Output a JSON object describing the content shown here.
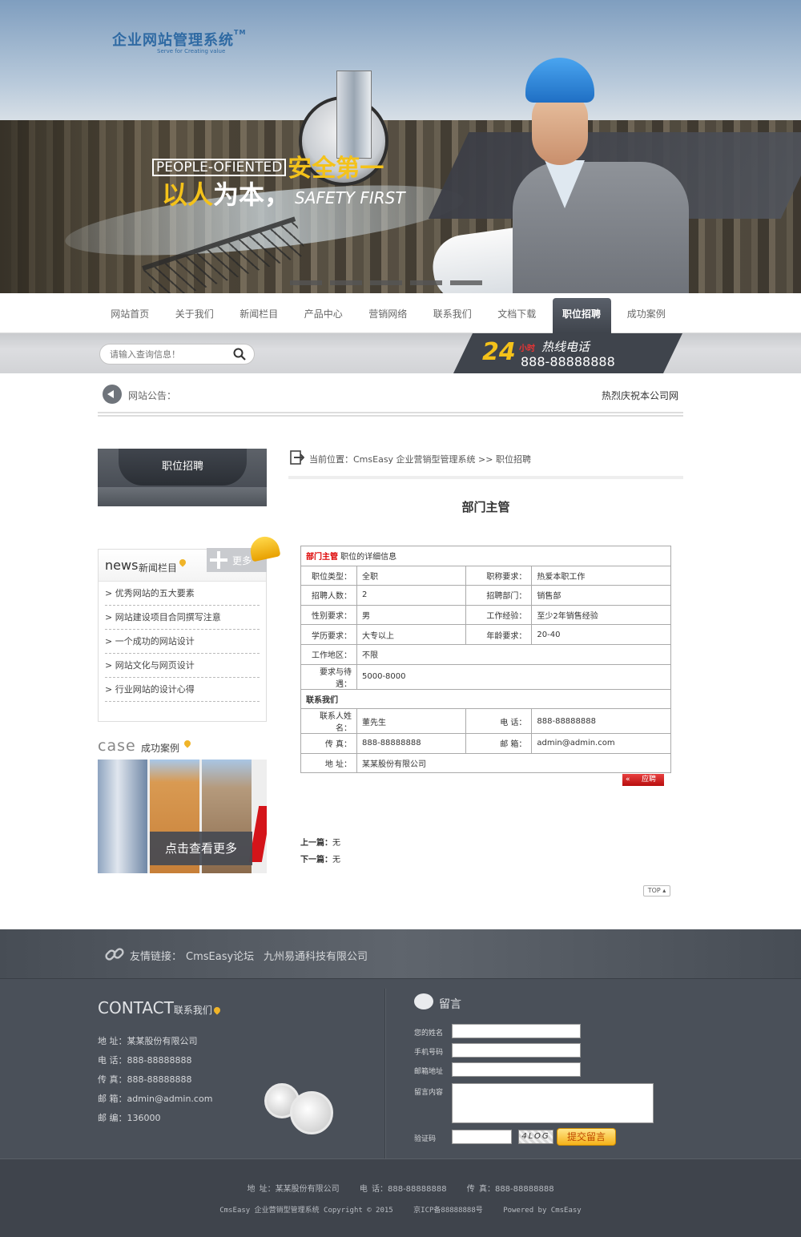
{
  "banner": {
    "logo_title": "企业网站管理系统",
    "logo_tm": "TM",
    "logo_sub": "Serve for Creating value",
    "slogan_en": "PEOPLE-OFIENTED",
    "slogan_cn1": "安全第一",
    "slogan_cn2_a": "以人",
    "slogan_cn2_b": "为本，",
    "slogan_en2": "SAFETY FIRST"
  },
  "nav": {
    "items": [
      {
        "label": "网站首页"
      },
      {
        "label": "关于我们"
      },
      {
        "label": "新闻栏目"
      },
      {
        "label": "产品中心"
      },
      {
        "label": "营销网络"
      },
      {
        "label": "联系我们"
      },
      {
        "label": "文档下载"
      },
      {
        "label": "职位招聘",
        "active": true
      },
      {
        "label": "成功案例"
      }
    ]
  },
  "search": {
    "placeholder": "请输入查询信息！"
  },
  "hotline": {
    "num": "24",
    "hours": "小时",
    "title": "热线电话",
    "tel": "888-88888888"
  },
  "notice": {
    "label": "网站公告：",
    "text": "热烈庆祝本公司网站"
  },
  "sidebar": {
    "title": "职位招聘",
    "news_en": "news",
    "news_cn": "新闻栏目",
    "more": "更多",
    "news_items": [
      "> 优秀网站的五大要素",
      "> 网站建设项目合同撰写注意",
      "> 一个成功的网站设计",
      "> 网站文化与网页设计",
      "> 行业网站的设计心得"
    ],
    "case_en": "case",
    "case_cn": "成功案例",
    "case_btn": "点击查看更多"
  },
  "breadcrumb": {
    "text": "当前位置：CmsEasy 企业营销型管理系统  >> 职位招聘"
  },
  "job": {
    "title": "部门主管",
    "head_red": "部门主管",
    "head_rest": " 职位的详细信息",
    "rows": {
      "type_l": "职位类型：",
      "type_v": "全职",
      "req_l": "职称要求：",
      "req_v": "热爱本职工作",
      "num_l": "招聘人数：",
      "num_v": "2",
      "dept_l": "招聘部门：",
      "dept_v": "销售部",
      "sex_l": "性别要求：",
      "sex_v": "男",
      "exp_l": "工作经验：",
      "exp_v": "至少2年销售经验",
      "edu_l": "学历要求：",
      "edu_v": "大专以上",
      "age_l": "年龄要求：",
      "age_v": "20-40",
      "loc_l": "工作地区：",
      "loc_v": "不限",
      "pay_l": "要求与待遇：",
      "pay_v": "5000-8000"
    },
    "contact_section": "联系我们",
    "contact": {
      "name_l": "联系人姓名：",
      "name_v": "董先生",
      "tel_l": "电  话：",
      "tel_v": "888-88888888",
      "fax_l": "传  真：",
      "fax_v": "888-88888888",
      "mail_l": "邮  箱：",
      "mail_v": "admin@admin.com",
      "addr_l": "地  址：",
      "addr_v": "某某股份有限公司"
    },
    "apply_chevron": "«",
    "apply_label": "应聘",
    "prev_l": "上一篇：",
    "prev_v": "无",
    "next_l": "下一篇：",
    "next_v": "无",
    "top": "TOP"
  },
  "footer": {
    "links_label": "友情链接：",
    "links": [
      "CmsEasy论坛",
      "九州易通科技有限公司"
    ],
    "contact_en": "CONTACT",
    "contact_cn": "联系我们",
    "contact_items": [
      "地 址：某某股份有限公司",
      "电 话：888-88888888",
      "传 真：888-88888888",
      "邮 箱：admin@admin.com",
      "邮 编：136000"
    ],
    "msg_title": "留言",
    "form": {
      "name": "您的姓名",
      "phone": "手机号码",
      "email": "邮箱地址",
      "content": "留言内容",
      "captcha": "验证码",
      "captcha_img": "4LOG",
      "submit": "提交留言"
    },
    "bottom_1": [
      "地 址：某某股份有限公司",
      "电 话：888-88888888",
      "传 真：888-88888888"
    ],
    "bottom_2": [
      "CmsEasy 企业营销型管理系统 Copyright © 2015",
      "京ICP备88888888号",
      "Powered by CmsEasy"
    ]
  }
}
